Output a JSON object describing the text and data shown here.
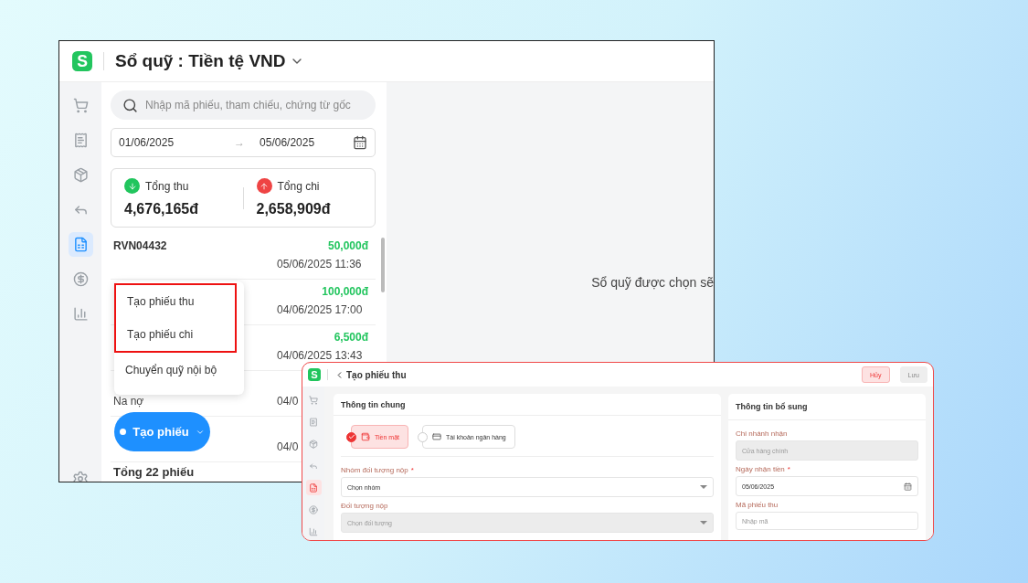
{
  "main_window": {
    "logo": "S",
    "title": "Sổ quỹ : Tiền tệ VND",
    "sidebar": [
      {
        "selected": false
      },
      {
        "selected": false
      },
      {
        "selected": false
      },
      {
        "selected": false
      },
      {
        "selected": true
      },
      {
        "selected": false
      },
      {
        "selected": false
      }
    ],
    "search": {
      "placeholder": "Nhập mã phiếu, tham chiếu, chứng từ gốc"
    },
    "date_range": {
      "from": "01/06/2025",
      "separator": "→",
      "to": "05/06/2025"
    },
    "totals": [
      {
        "kind": "income",
        "label": "Tổng thu",
        "amount": "4,676,165đ"
      },
      {
        "kind": "expense",
        "label": "Tổng chi",
        "amount": "2,658,909đ"
      }
    ],
    "vouchers": [
      {
        "code": "RVN04432",
        "amount": "50,000đ",
        "time": "05/06/2025 11:36"
      },
      {
        "amount": "100,000đ",
        "time": "04/06/2025 17:00"
      },
      {
        "amount": "6,500đ",
        "time": "04/06/2025 13:43"
      },
      {
        "name": "Na nợ",
        "time": "04/0"
      },
      {
        "time": "04/0"
      }
    ],
    "footer": "Tổng 22 phiếu",
    "create_menu": [
      {
        "label": "Tạo phiếu thu",
        "highlighted": true
      },
      {
        "label": "Tạo phiếu chi",
        "highlighted": true
      },
      {
        "label": "Chuyển quỹ nội bộ",
        "highlighted": false
      }
    ],
    "create_button": "Tạo phiếu",
    "empty_message": "Sổ quỹ được chọn sẽ"
  },
  "receipt_window": {
    "logo": "S",
    "title": "Tạo phiếu thu",
    "buttons": [
      {
        "label": "Hủy",
        "disabled": false
      },
      {
        "label": "Lưu",
        "disabled": true
      }
    ],
    "sidebar": [
      {
        "selected": false
      },
      {
        "selected": false
      },
      {
        "selected": false
      },
      {
        "selected": false
      },
      {
        "selected": true
      },
      {
        "selected": false
      },
      {
        "selected": false
      }
    ],
    "general": {
      "title": "Thông tin chung",
      "payment_methods": [
        {
          "kind": "cash",
          "label": "Tiền mặt",
          "selected": true
        },
        {
          "kind": "bank",
          "label": "Tài khoản ngân hàng",
          "selected": false
        }
      ],
      "fields": [
        {
          "kind": "select",
          "label": "Nhóm đối tượng nộp",
          "required_mark": "*",
          "disabled": false,
          "value": "Chọn nhóm"
        },
        {
          "kind": "select",
          "label": "Đối tượng nộp",
          "disabled": true,
          "value": "Chọn đối tượng"
        }
      ]
    },
    "extra": {
      "title": "Thông tin bổ sung",
      "fields": [
        {
          "kind": "text",
          "label": "Chi nhánh nhận",
          "disabled": true,
          "value": "Cửa hàng chính"
        },
        {
          "kind": "date",
          "label": "Ngày nhận tiền",
          "required_mark": "*",
          "disabled": false,
          "value": "05/06/2025"
        },
        {
          "kind": "text",
          "label": "Mã phiếu thu",
          "disabled": false,
          "placeholder": "Nhập mã"
        }
      ]
    }
  }
}
